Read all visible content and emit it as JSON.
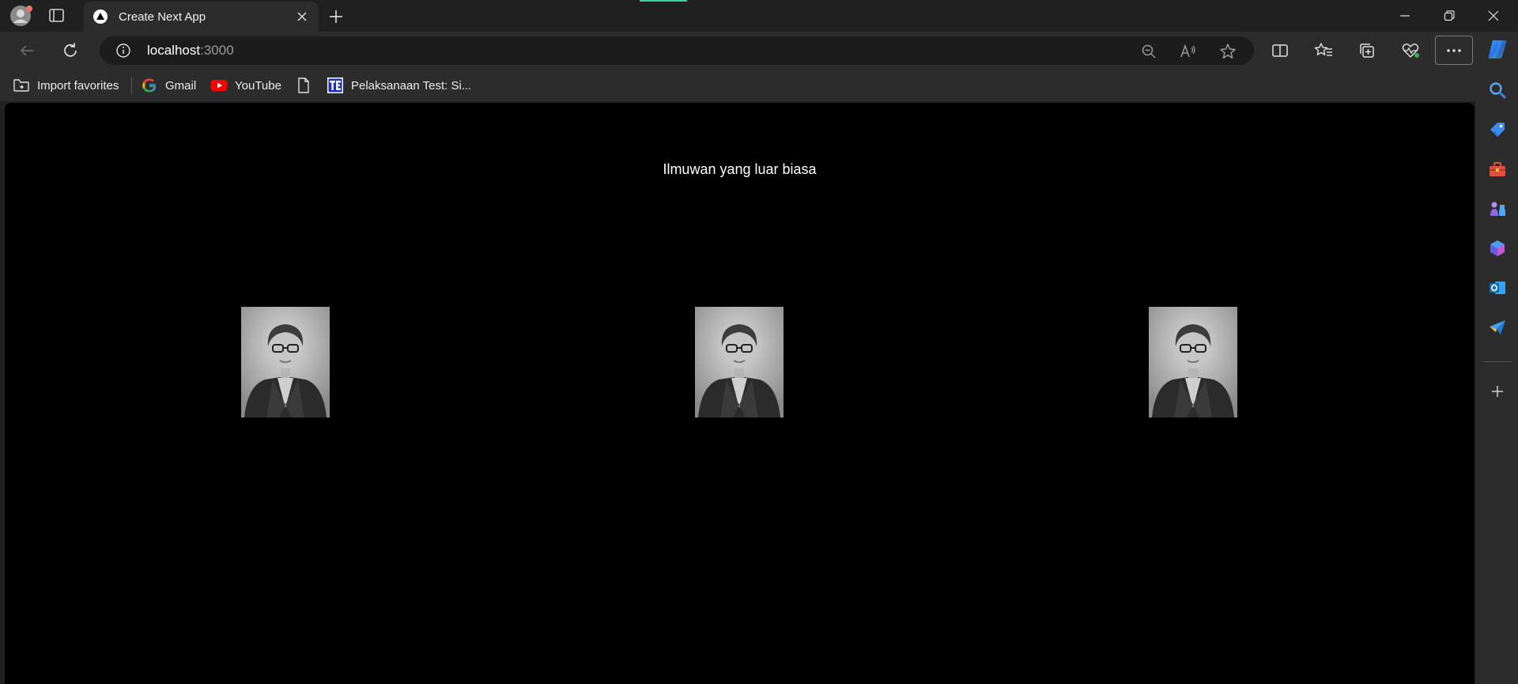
{
  "browser": {
    "tab": {
      "title": "Create Next App"
    },
    "address": {
      "host": "localhost",
      "port": ":3000"
    },
    "favorites": [
      {
        "label": "Import favorites",
        "icon": "import-favorites-icon"
      },
      {
        "label": "Gmail",
        "icon": "google-icon"
      },
      {
        "label": "YouTube",
        "icon": "youtube-icon"
      },
      {
        "label": "",
        "icon": "document-icon"
      },
      {
        "label": "Pelaksanaan Test: Si...",
        "icon": "te-logo-icon"
      }
    ],
    "colors": {
      "accent": "#3fd0a0",
      "frame": "#202020",
      "toolbar": "#2c2c2c",
      "page": "#000000"
    }
  },
  "page": {
    "heading": "Ilmuwan yang luar biasa",
    "images": [
      {
        "name": "scientist-portrait-1",
        "alt": "portrait"
      },
      {
        "name": "scientist-portrait-2",
        "alt": "portrait"
      },
      {
        "name": "scientist-portrait-3",
        "alt": "portrait"
      }
    ]
  }
}
